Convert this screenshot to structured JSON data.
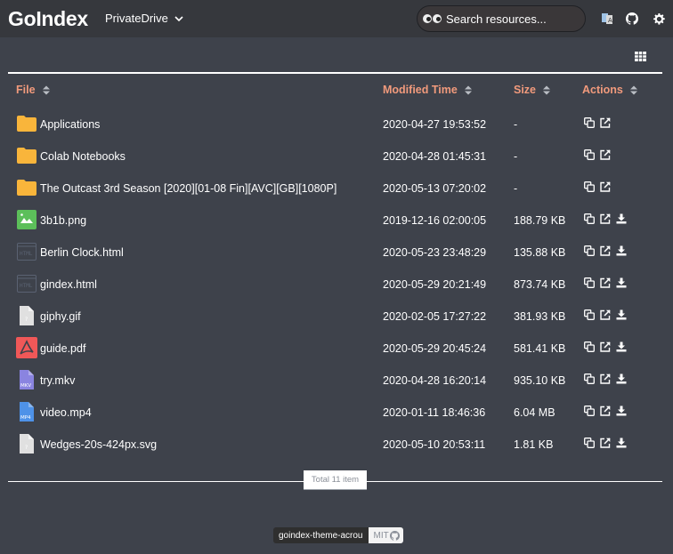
{
  "header": {
    "logo": "GoIndex",
    "drive": "PrivateDrive",
    "search_placeholder": "Search resources...",
    "icons": [
      "translate-icon",
      "github-icon",
      "gear-icon"
    ]
  },
  "toolbar": {
    "view_toggle_icon": "grid-icon"
  },
  "table": {
    "columns": [
      {
        "label": "File"
      },
      {
        "label": "Modified Time"
      },
      {
        "label": "Size"
      },
      {
        "label": "Actions"
      }
    ],
    "rows": [
      {
        "name": "Applications",
        "type": "folder",
        "modified": "2020-04-27 19:53:52",
        "size": "-",
        "actions": [
          "copy",
          "open"
        ]
      },
      {
        "name": "Colab Notebooks",
        "type": "folder",
        "modified": "2020-04-28 01:45:31",
        "size": "-",
        "actions": [
          "copy",
          "open"
        ]
      },
      {
        "name": "The Outcast 3rd Season [2020][01-08 Fin][AVC][GB][1080P]",
        "type": "folder",
        "modified": "2020-05-13 07:20:02",
        "size": "-",
        "actions": [
          "copy",
          "open"
        ]
      },
      {
        "name": "3b1b.png",
        "type": "image",
        "modified": "2019-12-16 02:00:05",
        "size": "188.79 KB",
        "actions": [
          "copy",
          "open",
          "download"
        ]
      },
      {
        "name": "Berlin Clock.html",
        "type": "html",
        "modified": "2020-05-23 23:48:29",
        "size": "135.88 KB",
        "actions": [
          "copy",
          "open",
          "download"
        ]
      },
      {
        "name": "gindex.html",
        "type": "html",
        "modified": "2020-05-29 20:21:49",
        "size": "873.74 KB",
        "actions": [
          "copy",
          "open",
          "download"
        ]
      },
      {
        "name": "giphy.gif",
        "type": "unknown",
        "modified": "2020-02-05 17:27:22",
        "size": "381.93 KB",
        "actions": [
          "copy",
          "open",
          "download"
        ]
      },
      {
        "name": "guide.pdf",
        "type": "pdf",
        "modified": "2020-05-29 20:45:24",
        "size": "581.41 KB",
        "actions": [
          "copy",
          "open",
          "download"
        ]
      },
      {
        "name": "try.mkv",
        "type": "mkv",
        "icon_label": "MKV",
        "modified": "2020-04-28 16:20:14",
        "size": "935.10 KB",
        "actions": [
          "copy",
          "open",
          "download"
        ]
      },
      {
        "name": "video.mp4",
        "type": "mp4",
        "icon_label": "MP4",
        "modified": "2020-01-11 18:46:36",
        "size": "6.04 MB",
        "actions": [
          "copy",
          "open",
          "download"
        ]
      },
      {
        "name": "Wedges-20s-424px.svg",
        "type": "unknown",
        "modified": "2020-05-10 20:53:11",
        "size": "1.81 KB",
        "actions": [
          "copy",
          "open",
          "download"
        ]
      }
    ]
  },
  "footer": {
    "total": "Total 11 item",
    "badge_left": "goindex-theme-acrou",
    "badge_right": "MIT"
  },
  "colors": {
    "header_bg": "#36383d",
    "page_bg": "#3e424b",
    "accent": "#f19a7c",
    "folder": "#f9b53b",
    "image": "#5cbf5a",
    "pdf": "#f05858",
    "mkv": "#8a84e0",
    "mp4": "#4e92e8"
  }
}
